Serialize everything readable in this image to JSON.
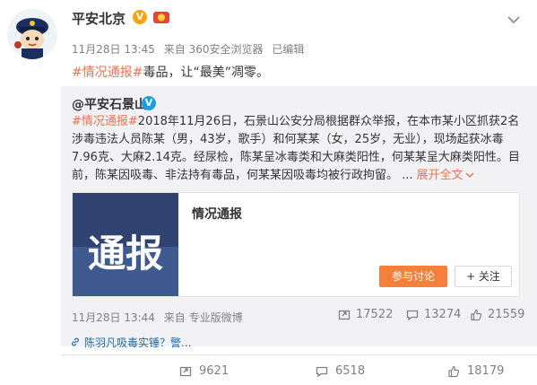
{
  "post": {
    "author": "平安北京",
    "date": "11月28日 13:45",
    "source": "来自 360安全浏览器",
    "edited": "已编辑",
    "hashtag": "#情况通报#",
    "text": "毒品，让“最美”凋零。"
  },
  "repost": {
    "author": "@平安石景山",
    "hashtag": "#情况通报#",
    "text": "2018年11月26日，石景山公安分局根据群众举报，在本市某小区抓获2名涉毒违法人员陈某（男，43岁，歌手）和何某某（女，25岁，无业），现场起获冰毒7.96克、大麻2.14克。经尿检，陈某呈冰毒类和大麻类阳性，何某某呈大麻类阳性。目前，陈某因吸毒、非法持有毒品，何某某因吸毒均被行政拘留。 ...",
    "expand_label": "展开全文",
    "card": {
      "image_text": "通报",
      "title": "情况通报",
      "join_label": "参与讨论",
      "follow_label": "+ 关注"
    },
    "date": "11月28日 13:44",
    "source": "来自 专业版微博",
    "stats": {
      "reposts": "17522",
      "comments": "13274",
      "likes": "21559"
    }
  },
  "suggestion": "陈羽凡吸毒实锤？警...",
  "bottom_stats": {
    "reposts": "9621",
    "comments": "6518",
    "likes": "18179"
  },
  "icons": [
    "police-avatar-icon",
    "verified-v-icon",
    "medal-icon",
    "chevron-down-icon",
    "repost-icon",
    "comment-icon",
    "like-icon",
    "link-icon"
  ],
  "colors": {
    "accent": "#eb7350",
    "join_button": "#f4803c",
    "verified_gold": "#f8a214",
    "verified_blue": "#1c9ee4",
    "card_image": "#3a4d78"
  }
}
